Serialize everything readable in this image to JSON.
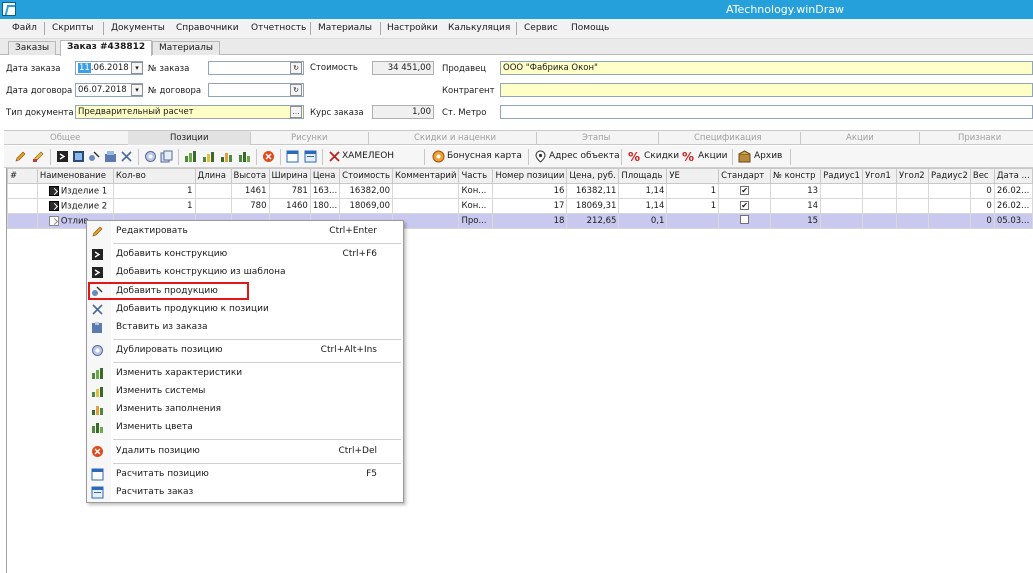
{
  "window": {
    "title": "ATechnology.winDraw"
  },
  "menu": [
    "Файл",
    "Скрипты",
    "Документы",
    "Справочники",
    "Отчетность",
    "Материалы",
    "Настройки",
    "Калькуляция",
    "Сервис",
    "Помощь"
  ],
  "doc_tabs": [
    "Заказы",
    "Заказ #438812",
    "Материалы"
  ],
  "form": {
    "order_date_label": "Дата заказа",
    "order_date_day": "11",
    "order_date_rest": ".06.2018",
    "order_no_label": "№ заказа",
    "cost_label": "Стоимость",
    "cost_value": "34 451,00",
    "seller_label": "Продавец",
    "seller_value": "ООО \"Фабрика Окон\"",
    "contract_date_label": "Дата договора",
    "contract_date_value": "06.07.2018",
    "contract_no_label": "№ договора",
    "counterparty_label": "Контрагент",
    "doc_type_label": "Тип документа",
    "doc_type_value": "Предварительный расчет",
    "rate_label": "Курс заказа",
    "rate_value": "1,00",
    "metro_label": "Ст. Метро"
  },
  "section_tabs": [
    "Общее",
    "Позиции",
    "Рисунки",
    "Скидки и наценки",
    "Этапы",
    "Спецификация",
    "Акции",
    "Признаки"
  ],
  "toolbar": {
    "chameleon": "ХАМЕЛЕОН",
    "bonus_card": "Бонусная карта",
    "object_address": "Адрес объекта",
    "discounts": "Скидки",
    "promotions": "Акции",
    "archive": "Архив"
  },
  "table": {
    "columns": [
      "#",
      "Наименование",
      "Кол-во",
      "Длина",
      "Высота",
      "Ширина",
      "Цена",
      "Стоимость",
      "Комментарий",
      "Часть",
      "Номер позиции",
      "Цена, руб.",
      "Площадь",
      "УЕ",
      "Стандарт",
      "№ констр",
      "Радиус1",
      "Угол1",
      "Угол2",
      "Радиус2",
      "Вес",
      "Дата ..."
    ],
    "rows": [
      {
        "name": "Изделие 1",
        "qty": "1",
        "length": "",
        "height": "1461",
        "width": "781",
        "price": "163...",
        "cost": "16382,00",
        "comment": "",
        "part": "Кон...",
        "pos_no": "16",
        "price_rub": "16382,11",
        "area": "1,14",
        "ue": "1",
        "std": "✔",
        "constr": "13",
        "weight": "0",
        "date": "26.02..."
      },
      {
        "name": "Изделие 2",
        "qty": "1",
        "length": "",
        "height": "780",
        "width": "1460",
        "price": "180...",
        "cost": "18069,00",
        "comment": "",
        "part": "Кон...",
        "pos_no": "17",
        "price_rub": "18069,31",
        "area": "1,14",
        "ue": "1",
        "std": "✔",
        "constr": "14",
        "weight": "0",
        "date": "26.02..."
      },
      {
        "name": "Отлив",
        "qty": "",
        "length": "",
        "height": "",
        "width": "",
        "price": "",
        "cost": "",
        "comment": "",
        "part": "Про...",
        "pos_no": "18",
        "price_rub": "212,65",
        "area": "0,1",
        "ue": "",
        "std": "",
        "constr": "15",
        "weight": "0",
        "date": "05.03..."
      }
    ]
  },
  "context_menu": {
    "items": [
      {
        "label": "Редактировать",
        "shortcut": "Ctrl+Enter",
        "icon": "pencil-icon"
      },
      {
        "label": "Добавить конструкцию",
        "shortcut": "Ctrl+F6",
        "icon": "construction-icon"
      },
      {
        "label": "Добавить конструкцию из шаблона",
        "shortcut": "",
        "icon": "template-icon"
      },
      {
        "label": "Добавить продукцию",
        "shortcut": "",
        "icon": "product-icon"
      },
      {
        "label": "Добавить продукцию к позиции",
        "shortcut": "",
        "icon": "product-to-position-icon"
      },
      {
        "label": "Вставить из заказа",
        "shortcut": "",
        "icon": "paste-icon"
      },
      {
        "label": "Дублировать позицию",
        "shortcut": "Ctrl+Alt+Ins",
        "icon": "duplicate-icon"
      },
      {
        "label": "Изменить характеристики",
        "shortcut": "",
        "icon": "characteristics-icon"
      },
      {
        "label": "Изменить системы",
        "shortcut": "",
        "icon": "systems-icon"
      },
      {
        "label": "Изменить заполнения",
        "shortcut": "",
        "icon": "fillings-icon"
      },
      {
        "label": "Изменить цвета",
        "shortcut": "",
        "icon": "colors-icon"
      },
      {
        "label": "Удалить позицию",
        "shortcut": "Ctrl+Del",
        "icon": "delete-icon"
      },
      {
        "label": "Расчитать позицию",
        "shortcut": "F5",
        "icon": "calc-position-icon"
      },
      {
        "label": "Расчитать заказ",
        "shortcut": "",
        "icon": "calc-order-icon"
      }
    ]
  },
  "colors": {
    "titlebar": "#26a0da",
    "selected_row": "#c9c9f0",
    "highlight_box": "#e01818",
    "yellow_field": "#ffffc8"
  }
}
